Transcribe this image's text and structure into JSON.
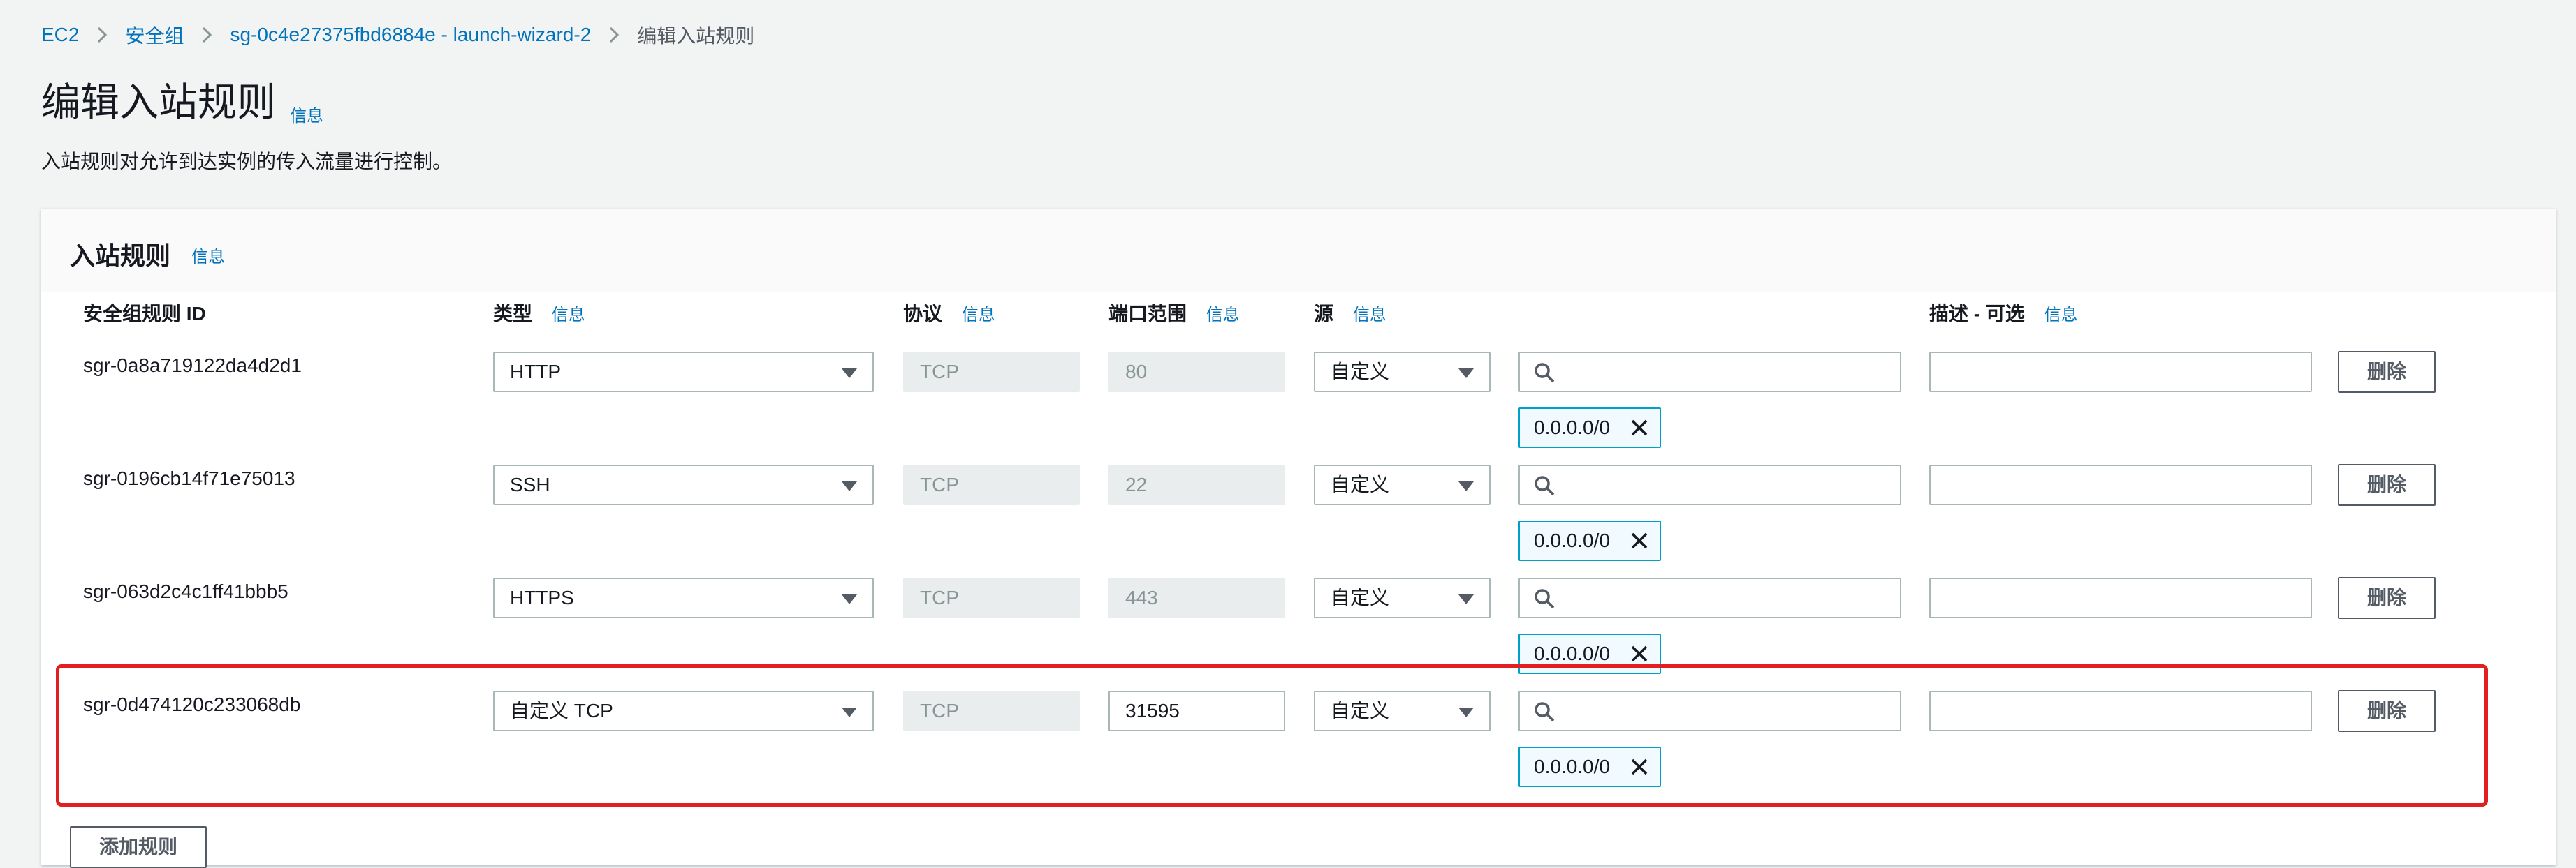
{
  "breadcrumb": {
    "items": [
      "EC2",
      "安全组",
      "sg-0c4e27375fbd6884e - launch-wizard-2"
    ],
    "current": "编辑入站规则"
  },
  "page": {
    "title": "编辑入站规则",
    "info": "信息",
    "description": "入站规则对允许到达实例的传入流量进行控制。"
  },
  "panel": {
    "title": "入站规则",
    "info": "信息"
  },
  "columns": {
    "rule_id": "安全组规则 ID",
    "type": "类型",
    "protocol": "协议",
    "port_range": "端口范围",
    "source": "源",
    "description": "描述 - 可选",
    "info": "信息"
  },
  "rules": [
    {
      "id": "sgr-0a8a719122da4d2d1",
      "type": "HTTP",
      "protocol": "TCP",
      "port": "80",
      "source": "自定义",
      "cidr": "0.0.0.0/0",
      "description": "",
      "delete": "删除"
    },
    {
      "id": "sgr-0196cb14f71e75013",
      "type": "SSH",
      "protocol": "TCP",
      "port": "22",
      "source": "自定义",
      "cidr": "0.0.0.0/0",
      "description": "",
      "delete": "删除"
    },
    {
      "id": "sgr-063d2c4c1ff41bbb5",
      "type": "HTTPS",
      "protocol": "TCP",
      "port": "443",
      "source": "自定义",
      "cidr": "0.0.0.0/0",
      "description": "",
      "delete": "删除"
    },
    {
      "id": "sgr-0d474120c233068db",
      "type": "自定义 TCP",
      "protocol": "TCP",
      "port": "31595",
      "source": "自定义",
      "cidr": "0.0.0.0/0",
      "description": "",
      "delete": "删除"
    }
  ],
  "add_rule": "添加规则",
  "colors": {
    "link": "#0073bb",
    "highlight": "#e11f1f",
    "token_border": "#00a1c9"
  }
}
